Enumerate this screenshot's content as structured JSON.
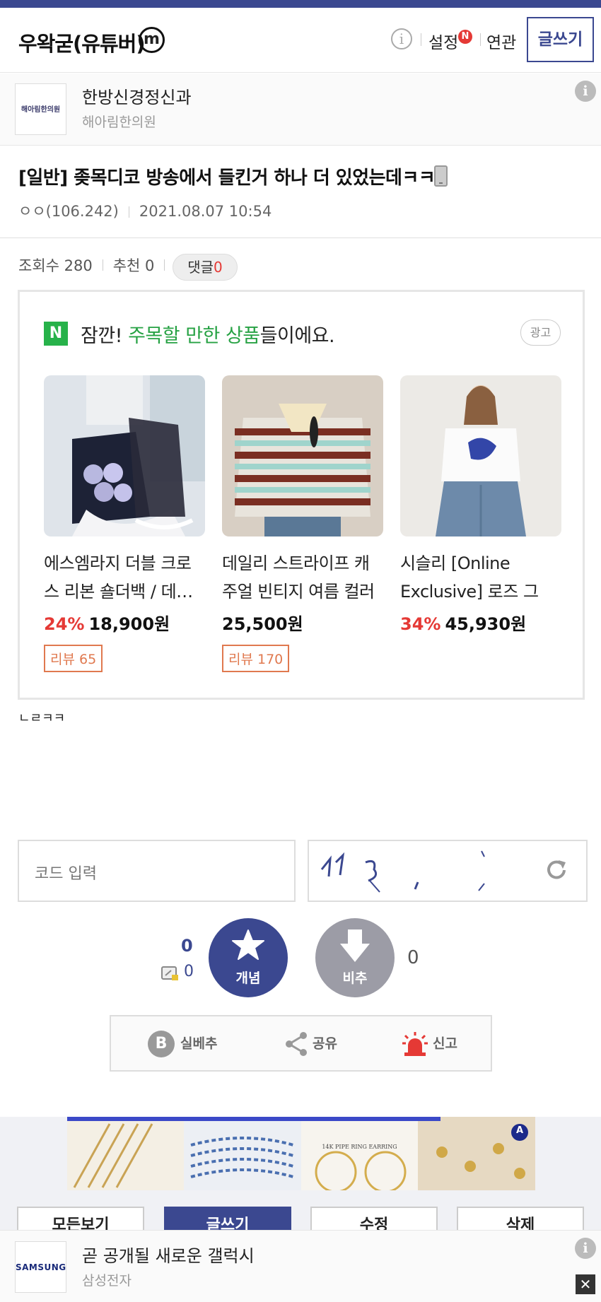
{
  "header": {
    "gallery_title": "우왁굳(유튜버)",
    "mini_badge": "m",
    "info_glyph": "i",
    "settings_label": "설정",
    "settings_badge": "N",
    "related_label": "연관",
    "write_label": "글쓰기"
  },
  "top_ad": {
    "logo_text": "해아림한의원",
    "title": "한방신경정신과",
    "subtitle": "해아림한의원",
    "info_glyph": "i"
  },
  "post": {
    "title": "[일반] 좆목디코 방송에서 들킨거 하나 더 있었는데ㅋㅋ",
    "author": "ㅇㅇ(106.242)",
    "datetime": "2021.08.07 10:54",
    "views_label": "조회수 280",
    "recommend_label": "추천 0",
    "comment_label": "댓글",
    "comment_count": "0",
    "body": "ㄴㄹㅋㅋ"
  },
  "shopping": {
    "badge": "N",
    "heading_prefix": "잠깐! ",
    "heading_highlight": "주목할 만한 상품",
    "heading_suffix": "들이에요.",
    "ad_label": "광고",
    "products": [
      {
        "name": "에스엠라지 더블 크로스 리본 숄더백 / 데…",
        "discount": "24%",
        "price": "18,900원",
        "review": "리뷰 65"
      },
      {
        "name": "데일리 스트라이프 캐주얼 빈티지 여름 컬러",
        "discount": "",
        "price": "25,500원",
        "review": "리뷰 170"
      },
      {
        "name": "시슬리 [Online Exclusive] 로즈 그래…",
        "discount": "34%",
        "price": "45,930원",
        "review": ""
      }
    ]
  },
  "captcha": {
    "placeholder": "코드 입력"
  },
  "vote": {
    "up_label": "개념",
    "up_count": "0",
    "up_fixed_count": "0",
    "down_label": "비추",
    "down_count": "0"
  },
  "actions": {
    "silbe_badge": "B",
    "silbe_label": "실베추",
    "share_label": "공유",
    "report_label": "신고"
  },
  "banner": {
    "earring_caption": "14K PIPE RING EARRING",
    "corner_badge": "A"
  },
  "nav": {
    "list_label": "모든보기",
    "write_label": "글쓰기",
    "edit_label": "수정",
    "delete_label": "삭제"
  },
  "bottom_ad": {
    "logo_text": "SAMSUNG",
    "title": "곧 공개될 새로운 갤럭시",
    "subtitle": "삼성전자",
    "info_glyph": "i",
    "close_glyph": "✕"
  },
  "colors": {
    "brand": "#3b4890",
    "accent_red": "#e53935",
    "ad_green": "#27a244",
    "review_orange": "#e0794f",
    "downvote_gray": "#9c9ca6"
  }
}
